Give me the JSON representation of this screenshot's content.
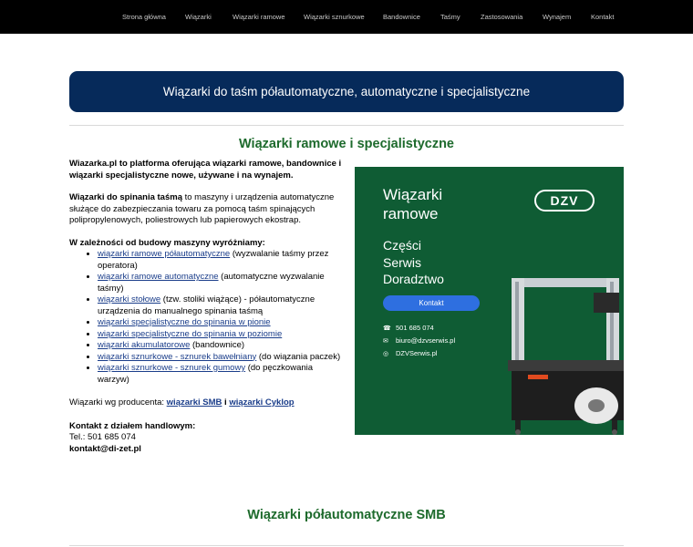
{
  "nav": {
    "items": [
      "Strona główna",
      "Wiązarki",
      "Wiązarki ramowe",
      "Wiązarki sznurkowe",
      "Bandownice",
      "Taśmy",
      "Zastosowania",
      "Wynajem",
      "Kontakt"
    ]
  },
  "banner": {
    "title": "Wiązarki do taśm półautomatyczne, automatyczne i specjalistyczne"
  },
  "section1": {
    "title": "Wiązarki ramowe i specjalistyczne",
    "intro": "Wiazarka.pl to platforma oferująca wiązarki ramowe, bandownice i wiązarki specjalistyczne nowe, używane i na wynajem.",
    "def_bold": "Wiązarki do spinania taśmą",
    "def_rest": " to maszyny i urządzenia automatyczne służące do zabezpieczania towaru za pomocą taśm spinających polipropylenowych, poliestrowych lub papierowych ekostrap.",
    "types_heading": "W zależności od budowy maszyny wyróżniamy:",
    "list": [
      {
        "link": "wiązarki ramowe półautomatyczne",
        "rest": " (wyzwalanie taśmy przez operatora)"
      },
      {
        "link": "wiązarki ramowe automatyczne",
        "rest": " (automatyczne wyzwalanie taśmy)"
      },
      {
        "link": "wiązarki stołowe",
        "rest": " (tzw. stoliki wiążące) - półautomatyczne urządzenia do manualnego spinania taśmą"
      },
      {
        "link": "wiązarki specjalistyczne do spinania w pionie",
        "rest": ""
      },
      {
        "link": "wiązarki specjalistyczne do spinania w poziomie",
        "rest": ""
      },
      {
        "link": "wiązarki akumulatorowe",
        "rest": " (bandownice)"
      },
      {
        "link": "wiązarki sznurkowe - sznurek bawełniany",
        "rest": " (do wiązania paczek)"
      },
      {
        "link": "wiązarki sznurkowe - sznurek gumowy",
        "rest": " (do pęczkowania warzyw)"
      }
    ],
    "producer_label": "Wiązarki wg producenta: ",
    "producer_link1": "wiązarki SMB",
    "producer_sep": " i ",
    "producer_link2": "wiązarki Cyklop",
    "contact_heading": "Kontakt z działem handlowym:",
    "contact_tel": "Tel.: 501 685 074",
    "contact_email": "kontakt@di-zet.pl"
  },
  "ad": {
    "headline_line1": "Wiązarki",
    "headline_line2": "ramowe",
    "sub_line1": "Części",
    "sub_line2": "Serwis",
    "sub_line3": "Doradztwo",
    "logo": "DZV",
    "button": "Kontakt",
    "phone": "501 685 074",
    "email": "biuro@dzvserwis.pl",
    "social": "DZVSerwis.pl",
    "colors": {
      "background": "#0f5c34",
      "button": "#2e6fe0",
      "machine_table": "#e04a1f"
    }
  },
  "section2": {
    "title": "Wiązarki półautomatyczne SMB"
  },
  "colors": {
    "nav_bg": "#000000",
    "banner_bg": "#062a5a",
    "heading_green": "#1d6a2c",
    "link": "#1a3d8a"
  }
}
